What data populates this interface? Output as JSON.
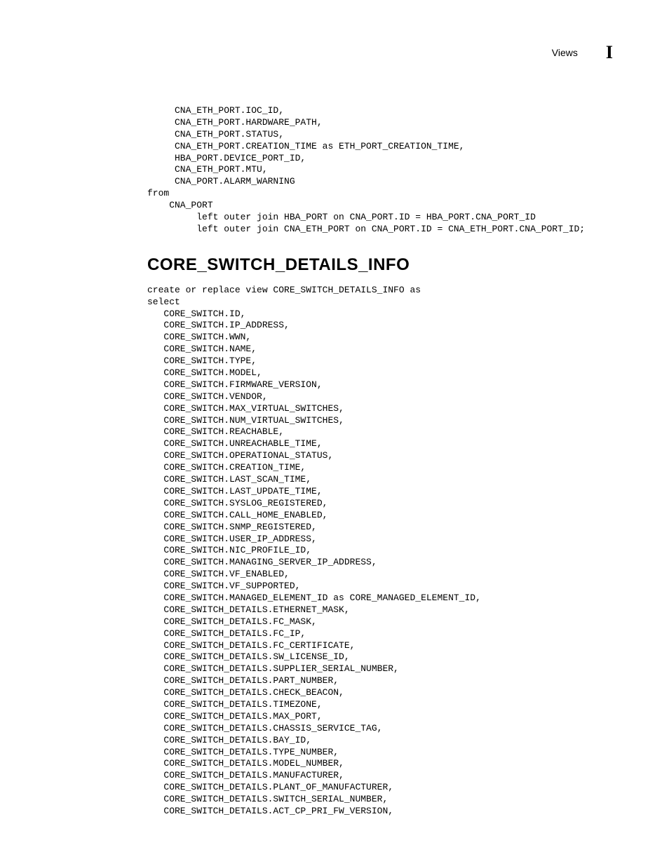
{
  "header": {
    "section": "Views",
    "letter": "I"
  },
  "code_block_1": "     CNA_ETH_PORT.IOC_ID,\n     CNA_ETH_PORT.HARDWARE_PATH,\n     CNA_ETH_PORT.STATUS,\n     CNA_ETH_PORT.CREATION_TIME as ETH_PORT_CREATION_TIME,\n     HBA_PORT.DEVICE_PORT_ID,\n     CNA_ETH_PORT.MTU,\n     CNA_PORT.ALARM_WARNING\nfrom\n    CNA_PORT\n         left outer join HBA_PORT on CNA_PORT.ID = HBA_PORT.CNA_PORT_ID\n         left outer join CNA_ETH_PORT on CNA_PORT.ID = CNA_ETH_PORT.CNA_PORT_ID;",
  "heading": "CORE_SWITCH_DETAILS_INFO",
  "code_block_2": "create or replace view CORE_SWITCH_DETAILS_INFO as\nselect\n   CORE_SWITCH.ID,\n   CORE_SWITCH.IP_ADDRESS,\n   CORE_SWITCH.WWN,\n   CORE_SWITCH.NAME,\n   CORE_SWITCH.TYPE,\n   CORE_SWITCH.MODEL,\n   CORE_SWITCH.FIRMWARE_VERSION,\n   CORE_SWITCH.VENDOR,\n   CORE_SWITCH.MAX_VIRTUAL_SWITCHES,\n   CORE_SWITCH.NUM_VIRTUAL_SWITCHES,\n   CORE_SWITCH.REACHABLE,\n   CORE_SWITCH.UNREACHABLE_TIME,\n   CORE_SWITCH.OPERATIONAL_STATUS,\n   CORE_SWITCH.CREATION_TIME,\n   CORE_SWITCH.LAST_SCAN_TIME,\n   CORE_SWITCH.LAST_UPDATE_TIME,\n   CORE_SWITCH.SYSLOG_REGISTERED,\n   CORE_SWITCH.CALL_HOME_ENABLED,\n   CORE_SWITCH.SNMP_REGISTERED,\n   CORE_SWITCH.USER_IP_ADDRESS,\n   CORE_SWITCH.NIC_PROFILE_ID,\n   CORE_SWITCH.MANAGING_SERVER_IP_ADDRESS,\n   CORE_SWITCH.VF_ENABLED,\n   CORE_SWITCH.VF_SUPPORTED,\n   CORE_SWITCH.MANAGED_ELEMENT_ID as CORE_MANAGED_ELEMENT_ID,\n   CORE_SWITCH_DETAILS.ETHERNET_MASK,\n   CORE_SWITCH_DETAILS.FC_MASK,\n   CORE_SWITCH_DETAILS.FC_IP,\n   CORE_SWITCH_DETAILS.FC_CERTIFICATE,\n   CORE_SWITCH_DETAILS.SW_LICENSE_ID,\n   CORE_SWITCH_DETAILS.SUPPLIER_SERIAL_NUMBER,\n   CORE_SWITCH_DETAILS.PART_NUMBER,\n   CORE_SWITCH_DETAILS.CHECK_BEACON,\n   CORE_SWITCH_DETAILS.TIMEZONE,\n   CORE_SWITCH_DETAILS.MAX_PORT,\n   CORE_SWITCH_DETAILS.CHASSIS_SERVICE_TAG,\n   CORE_SWITCH_DETAILS.BAY_ID,\n   CORE_SWITCH_DETAILS.TYPE_NUMBER,\n   CORE_SWITCH_DETAILS.MODEL_NUMBER,\n   CORE_SWITCH_DETAILS.MANUFACTURER,\n   CORE_SWITCH_DETAILS.PLANT_OF_MANUFACTURER,\n   CORE_SWITCH_DETAILS.SWITCH_SERIAL_NUMBER,\n   CORE_SWITCH_DETAILS.ACT_CP_PRI_FW_VERSION,"
}
